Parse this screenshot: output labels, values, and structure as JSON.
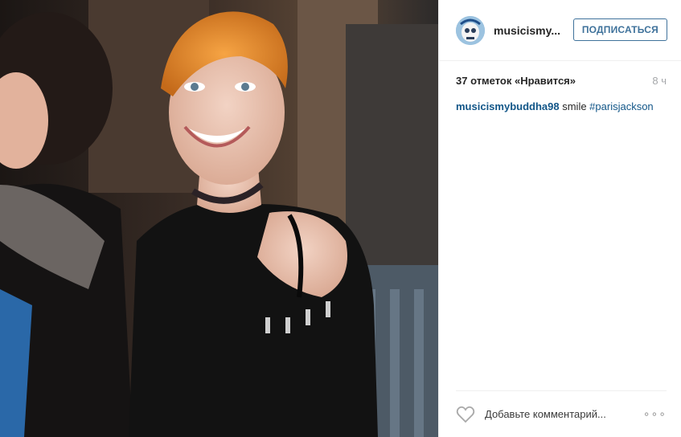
{
  "post": {
    "photo_icon": "photo",
    "header": {
      "username": "musicismy...",
      "avatar_icon": "avatar-skull",
      "follow_label": "ПОДПИСАТЬСЯ"
    },
    "likes_text": "37 отметок «Нравится»",
    "time_ago": "8 ч",
    "caption": {
      "username": "musicismybuddha98",
      "text": " smile ",
      "hashtag": "#parisjackson"
    },
    "footer": {
      "like_icon": "heart-icon",
      "comment_placeholder": "Добавьте комментарий...",
      "more_label": "∘∘∘",
      "more_icon": "more-options-icon"
    }
  },
  "colors": {
    "link": "#125688",
    "follow": "#3f729b",
    "muted": "#a5a7aa",
    "border": "#efefef"
  }
}
